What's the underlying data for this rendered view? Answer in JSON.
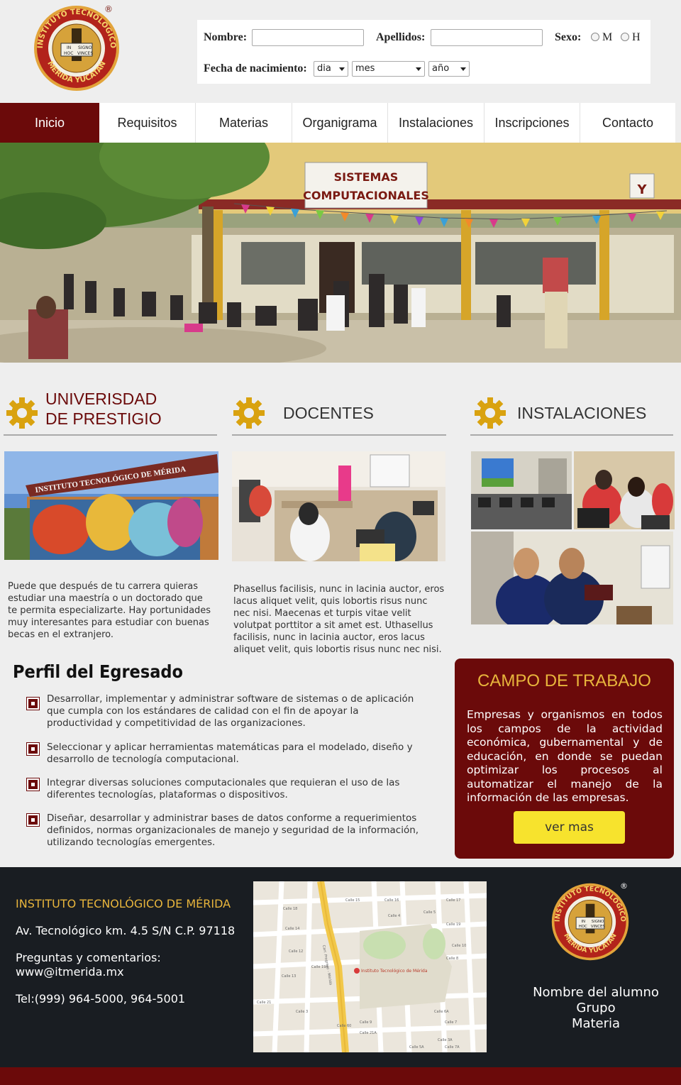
{
  "header": {
    "logo_alt": "Instituto Tecnológico Mérida Yucatán",
    "logo_text_top": "INSTITUTO TECNOLOGICO",
    "logo_text_bottom": "MERIDA YUCATAN",
    "logo_inner": [
      "IN",
      "SIGNO",
      "HOC",
      "VINCES"
    ],
    "registered": "®",
    "form": {
      "nombre_label": "Nombre:",
      "apellidos_label": "Apellidos:",
      "sexo_label": "Sexo:",
      "sexo_options": [
        "M",
        "H"
      ],
      "fecha_label": "Fecha de nacimiento:",
      "dia": "dia",
      "mes": "mes",
      "anio": "año"
    }
  },
  "nav": {
    "items": [
      "Inicio",
      "Requisitos",
      "Materias",
      "Organigrama",
      "Instalaciones",
      "Inscripciones",
      "Contacto"
    ],
    "active": "Inicio"
  },
  "hero": {
    "sign_line1": "SISTEMAS",
    "sign_line2": "COMPUTACIONALES",
    "building": "Y"
  },
  "sections": {
    "universidad": {
      "title_line1": "UNIVERISDAD",
      "title_line2": "DE PRESTIGIO",
      "photo_sign": "INSTITUTO TECNOLÓGICO DE MÉRIDA",
      "text": "Puede que después de tu carrera quieras estudiar una maestría o un doctorado que te permita especializarte. Hay portunidades muy interesantes para estudiar con buenas becas en el extranjero."
    },
    "docentes": {
      "title": "DOCENTES",
      "text": "Phasellus facilisis, nunc in lacinia auctor, eros lacus aliquet velit, quis lobortis risus nunc nec nisi. Maecenas et turpis vitae velit volutpat porttitor a sit amet est. Uthasellus facilisis, nunc in lacinia auctor, eros lacus aliquet velit, quis lobortis risus nunc nec nisi."
    },
    "instalaciones": {
      "title": "INSTALACIONES"
    }
  },
  "perfil": {
    "title": "Perfil del Egresado",
    "items": [
      "Desarrollar, implementar y administrar software de sistemas o de aplicación que cumpla con los estándares de calidad con el fin de apoyar la productividad y competitividad de las organizaciones.",
      "Seleccionar y aplicar herramientas matemáticas para el modelado, diseño y desarrollo de tecnología computacional.",
      "Integrar diversas soluciones computacionales que requieran el uso de las diferentes tecnologías, plataformas o dispositivos.",
      "Diseñar, desarrollar y administrar bases de datos conforme a requerimientos definidos, normas organizacionales de manejo y seguridad de la información, utilizando tecnologías emergentes."
    ]
  },
  "campo": {
    "title": "CAMPO DE TRABAJO",
    "text": "Empresas y organismos en todos los campos de la actividad económica, gubernamental y de educación, en donde se puedan optimizar los procesos al automatizar el manejo de la información de las empresas.",
    "button": "ver mas"
  },
  "footer": {
    "institute": "INSTITUTO TECNOLÓGICO DE MÉRIDA",
    "address": "Av. Tecnológico km. 4.5 S/N C.P. 97118",
    "questions_label": "Preguntas y comentarios:",
    "web": "www@itmerida.mx",
    "tel": "Tel:(999) 964-5000, 964-5001",
    "map_pin": "Instituto Tecnológico de Mérida",
    "streets": [
      "Calle 15",
      "Calle 16",
      "Calle 17",
      "Calle 19",
      "Calle 14",
      "Calle 12",
      "Calle 10",
      "Calle 21",
      "Calle 19A",
      "Calle 3A",
      "Calle 7",
      "Calle 9",
      "Calle 60",
      "Calle 8",
      "Calle 4",
      "Calle 6A",
      "Calle 5",
      "Calle 13",
      "Calle 3",
      "Calle 21A",
      "Calle 18",
      "Calle 7A",
      "Calle 5A",
      "Carr. Progreso - Mérida"
    ],
    "student_name": "Nombre del alumno",
    "group": "Grupo",
    "subject": "Materia"
  },
  "colors": {
    "maroon": "#6b0a0a",
    "gold": "#e8b53c",
    "button_yellow": "#f7e32d",
    "footer_bg": "#191d22",
    "gear": "#d9a20f"
  }
}
